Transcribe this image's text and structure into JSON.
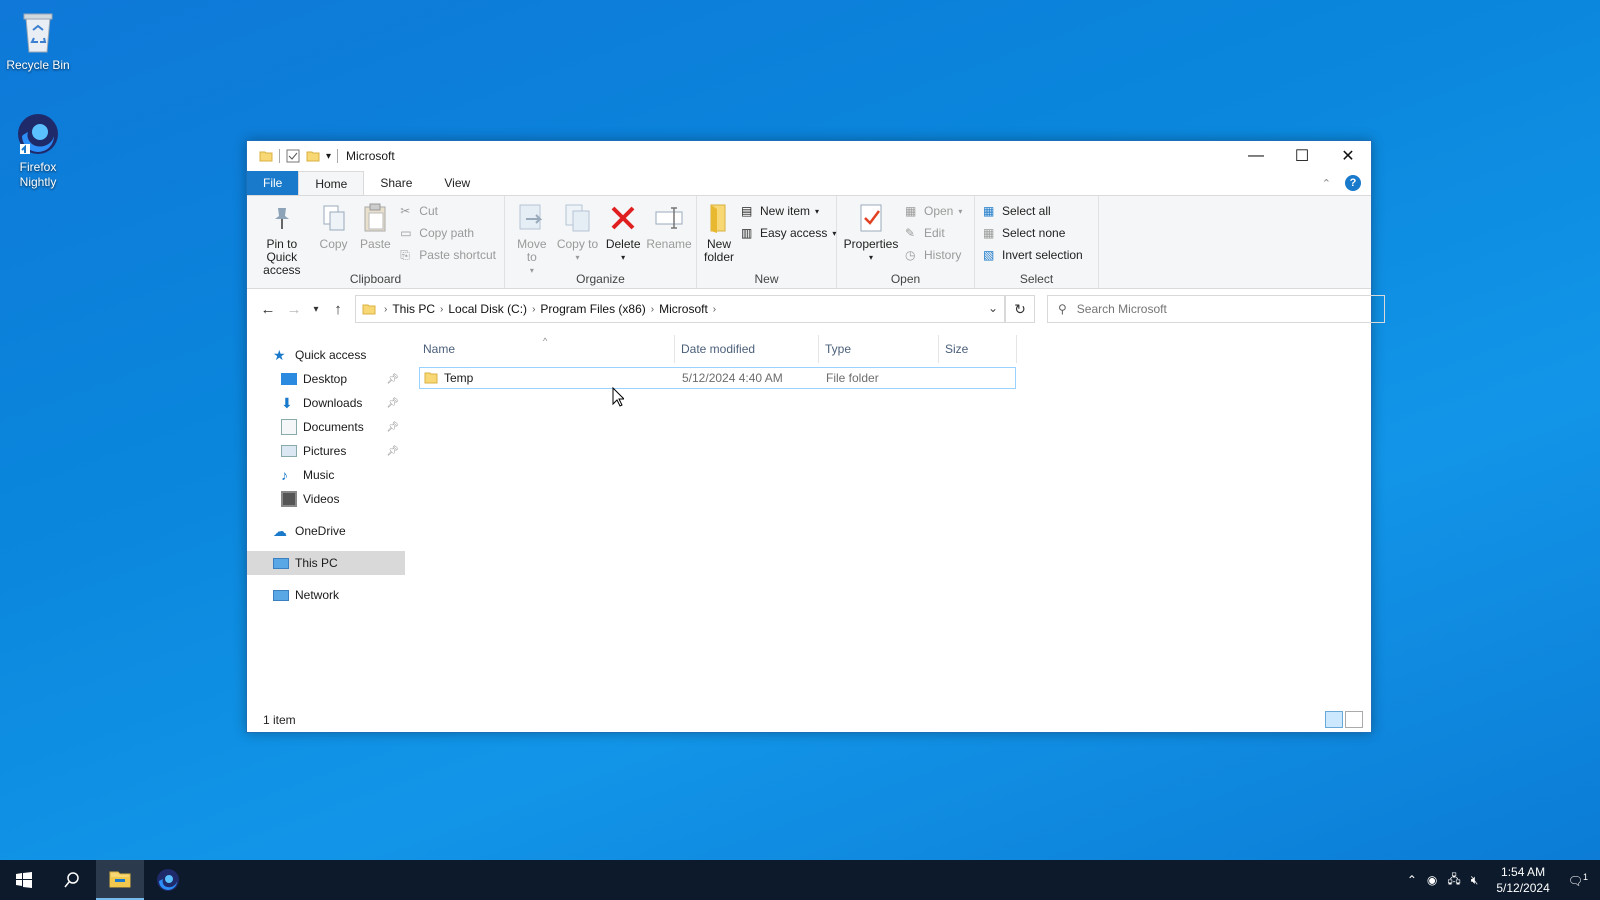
{
  "desktop": {
    "icons": [
      {
        "label": "Recycle Bin"
      },
      {
        "label": "Firefox Nightly"
      }
    ]
  },
  "window": {
    "title": "Microsoft",
    "tabs": [
      "File",
      "Home",
      "Share",
      "View"
    ],
    "active_tab": "Home",
    "ribbon": {
      "clipboard": {
        "label": "Clipboard",
        "pin": "Pin to Quick access",
        "copy": "Copy",
        "paste": "Paste",
        "cut": "Cut",
        "copy_path": "Copy path",
        "paste_shortcut": "Paste shortcut"
      },
      "organize": {
        "label": "Organize",
        "move_to": "Move to",
        "copy_to": "Copy to",
        "delete": "Delete",
        "rename": "Rename"
      },
      "new": {
        "label": "New",
        "new_folder": "New folder",
        "new_item": "New item",
        "easy_access": "Easy access"
      },
      "open": {
        "label": "Open",
        "properties": "Properties",
        "open": "Open",
        "edit": "Edit",
        "history": "History"
      },
      "select": {
        "label": "Select",
        "select_all": "Select all",
        "select_none": "Select none",
        "invert": "Invert selection"
      }
    },
    "breadcrumb": [
      "This PC",
      "Local Disk (C:)",
      "Program Files (x86)",
      "Microsoft"
    ],
    "search_placeholder": "Search Microsoft",
    "nav": {
      "quick_access": "Quick access",
      "desktop": "Desktop",
      "downloads": "Downloads",
      "documents": "Documents",
      "pictures": "Pictures",
      "music": "Music",
      "videos": "Videos",
      "onedrive": "OneDrive",
      "this_pc": "This PC",
      "network": "Network"
    },
    "columns": {
      "name": "Name",
      "date": "Date modified",
      "type": "Type",
      "size": "Size"
    },
    "files": [
      {
        "name": "Temp",
        "date": "5/12/2024 4:40 AM",
        "type": "File folder",
        "size": ""
      }
    ],
    "status": "1 item"
  },
  "taskbar": {
    "time": "1:54 AM",
    "date": "5/12/2024",
    "notification_count": "1"
  }
}
